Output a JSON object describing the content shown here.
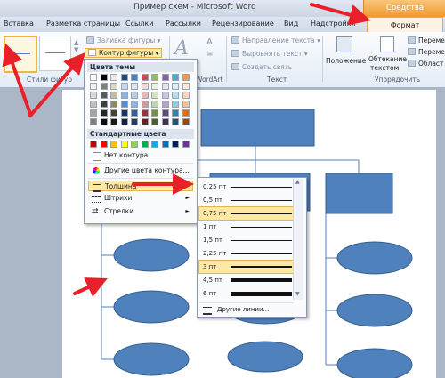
{
  "window": {
    "title": "Пример схем - Microsoft Word",
    "context_tab": "Средства рисования"
  },
  "tabs": [
    "Вставка",
    "Разметка страницы",
    "Ссылки",
    "Рассылки",
    "Рецензирование",
    "Вид",
    "Надстройки"
  ],
  "active_tab": "Формат",
  "ribbon": {
    "shape_fill": "Заливка фигуры",
    "shape_outline": "Контур фигуры",
    "styles_group": "Стили фигур",
    "wordart_group": "WordArt",
    "text_direction": "Направление текста",
    "align_text": "Выровнять текст",
    "create_link": "Создать связь",
    "text_group": "Текст",
    "position": "Положение",
    "wrap_text_1": "Обтекание",
    "wrap_text_2": "текстом",
    "forward": "Перемес",
    "backward": "Перемес",
    "area": "Област",
    "arrange_group": "Упорядочить"
  },
  "outline_menu": {
    "theme_colors_header": "Цвета темы",
    "standard_colors_header": "Стандартные цвета",
    "no_outline": "Нет контура",
    "more_colors": "Другие цвета контура...",
    "weight": "Толщина",
    "dashes": "Штрихи",
    "arrows": "Стрелки",
    "theme_colors": [
      [
        "#ffffff",
        "#000000",
        "#eeece1",
        "#1f497d",
        "#4f81bd",
        "#c0504d",
        "#9bbb59",
        "#8064a2",
        "#4bacc6",
        "#f79646"
      ],
      [
        "#f2f2f2",
        "#7f7f7f",
        "#ddd9c3",
        "#c6d9f0",
        "#dbe5f1",
        "#f2dcdb",
        "#ebf1dd",
        "#e5e0ec",
        "#dbeef3",
        "#fdeada"
      ],
      [
        "#d8d8d8",
        "#595959",
        "#c4bd97",
        "#8db3e2",
        "#b8cce4",
        "#e5b9b7",
        "#d7e3bc",
        "#ccc1d9",
        "#b7dde8",
        "#fbd5b5"
      ],
      [
        "#bfbfbf",
        "#3f3f3f",
        "#938953",
        "#548dd4",
        "#95b3d7",
        "#d99694",
        "#c3d69b",
        "#b2a2c7",
        "#92cddc",
        "#fac08f"
      ],
      [
        "#a5a5a5",
        "#262626",
        "#494429",
        "#17365d",
        "#366092",
        "#953734",
        "#76923c",
        "#5f497a",
        "#31859b",
        "#e36c09"
      ],
      [
        "#7f7f7f",
        "#0c0c0c",
        "#1d1b10",
        "#0f243e",
        "#244061",
        "#632423",
        "#4f6128",
        "#3f3151",
        "#205867",
        "#974806"
      ]
    ],
    "standard_colors": [
      "#c00000",
      "#ff0000",
      "#ffc000",
      "#ffff00",
      "#92d050",
      "#00b050",
      "#00b0f0",
      "#0070c0",
      "#002060",
      "#7030a0"
    ]
  },
  "weight_submenu": {
    "items": [
      {
        "label": "0,25 пт",
        "weight_pt": 0.25
      },
      {
        "label": "0,5 пт",
        "weight_pt": 0.5
      },
      {
        "label": "0,75 пт",
        "weight_pt": 0.75
      },
      {
        "label": "1 пт",
        "weight_pt": 1
      },
      {
        "label": "1,5 пт",
        "weight_pt": 1.5
      },
      {
        "label": "2,25 пт",
        "weight_pt": 2.25
      },
      {
        "label": "3 пт",
        "weight_pt": 3
      },
      {
        "label": "4,5 пт",
        "weight_pt": 4.5
      },
      {
        "label": "6 пт",
        "weight_pt": 6
      }
    ],
    "more_lines": "Другие линии..."
  },
  "colors": {
    "accent": "#ef9a2c",
    "annotation_red": "#e8202a",
    "shape_fill": "#4f81bd",
    "shape_border": "#385d8a",
    "menu_highlight": "#fde8a6"
  }
}
